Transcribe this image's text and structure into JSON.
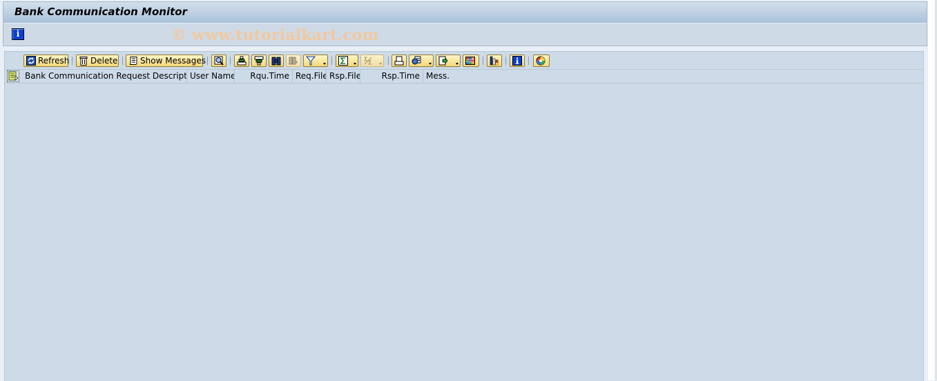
{
  "window": {
    "title": "Bank Communication Monitor"
  },
  "app_toolbar": {
    "info_icon": "info-icon",
    "info_glyph": "i",
    "watermark": "© www.tutorialkart.com"
  },
  "grid_toolbar": {
    "buttons": [
      {
        "name": "refresh",
        "label": "Refresh",
        "icon": "refresh-icon"
      },
      {
        "name": "delete",
        "label": "Delete",
        "icon": "trash-icon"
      },
      {
        "name": "show-messages",
        "label": "Show Messages",
        "icon": "scroll-icon"
      },
      {
        "name": "details",
        "label": "",
        "icon": "magnifier-detail-icon"
      },
      {
        "name": "sort-ascending",
        "label": "",
        "icon": "sort-ascending-icon"
      },
      {
        "name": "sort-descending",
        "label": "",
        "icon": "sort-descending-icon"
      },
      {
        "name": "find",
        "label": "",
        "icon": "binoculars-icon"
      },
      {
        "name": "find-next",
        "label": "",
        "icon": "find-next-icon",
        "disabled": true
      },
      {
        "name": "filter",
        "label": "",
        "icon": "filter-icon",
        "dropdown": true
      },
      {
        "name": "total",
        "label": "",
        "icon": "sum-icon",
        "dropdown": true
      },
      {
        "name": "subtotal",
        "label": "",
        "icon": "subtotal-icon",
        "dropdown": true,
        "disabled": true
      },
      {
        "name": "print-preview",
        "label": "",
        "icon": "print-preview-icon"
      },
      {
        "name": "views",
        "label": "",
        "icon": "views-icon",
        "dropdown": true
      },
      {
        "name": "export",
        "label": "",
        "icon": "export-icon",
        "dropdown": true
      },
      {
        "name": "change-layout",
        "label": "",
        "icon": "layout-grid-icon"
      },
      {
        "name": "graphic",
        "label": "",
        "icon": "bar-chart-icon"
      },
      {
        "name": "information",
        "label": "",
        "icon": "info-icon"
      },
      {
        "name": "abc-analysis",
        "label": "",
        "icon": "color-wheel-icon"
      }
    ]
  },
  "table": {
    "row_selector_icon": "select-all-icon",
    "columns": [
      {
        "label": "Bank Communication Request Description",
        "align": "left"
      },
      {
        "label": "User Name",
        "align": "left"
      },
      {
        "label": "Rqu.Time",
        "align": "right"
      },
      {
        "label": "Req.File",
        "align": "left"
      },
      {
        "label": "Rsp.File",
        "align": "left"
      },
      {
        "label": "Rsp.Time",
        "align": "right"
      },
      {
        "label": "Mess.",
        "align": "left"
      }
    ],
    "rows": []
  }
}
